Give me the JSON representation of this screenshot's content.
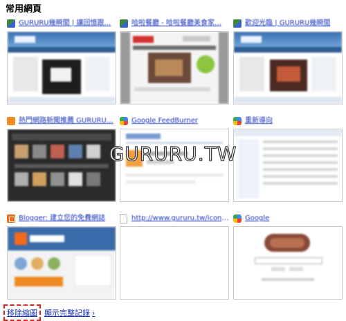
{
  "header": {
    "title": "常用網頁"
  },
  "tiles": [
    {
      "title": "GURURU幾瞬間 | 讓回憶跟…",
      "favicon": "guru-icon"
    },
    {
      "title": "哈啦餐廳 - 哈啦餐廳美食家…",
      "favicon": "guru-icon"
    },
    {
      "title": "歡迎光臨 | GURURU幾瞬間",
      "favicon": "guru-icon"
    },
    {
      "title": "熱門網路新聞推薦 GURURU…",
      "favicon": "rss-icon"
    },
    {
      "title": "Google FeedBurner",
      "favicon": "google-icon"
    },
    {
      "title": "重新導向",
      "favicon": "google-icon"
    },
    {
      "title": "Blogger: 建立您的免費網誌",
      "favicon": "blogger-icon"
    },
    {
      "title": "http://www.gururu.tw/icon.php",
      "favicon": "page-icon"
    },
    {
      "title": "Google",
      "favicon": "google-icon"
    }
  ],
  "watermark": "GURURU.TW",
  "footer": {
    "remove_label": "移除縮圖",
    "history_label": "顯示完整記錄",
    "chevron": "›"
  },
  "colors": {
    "link": "#1a35b8",
    "highlight_border": "#e02020"
  }
}
